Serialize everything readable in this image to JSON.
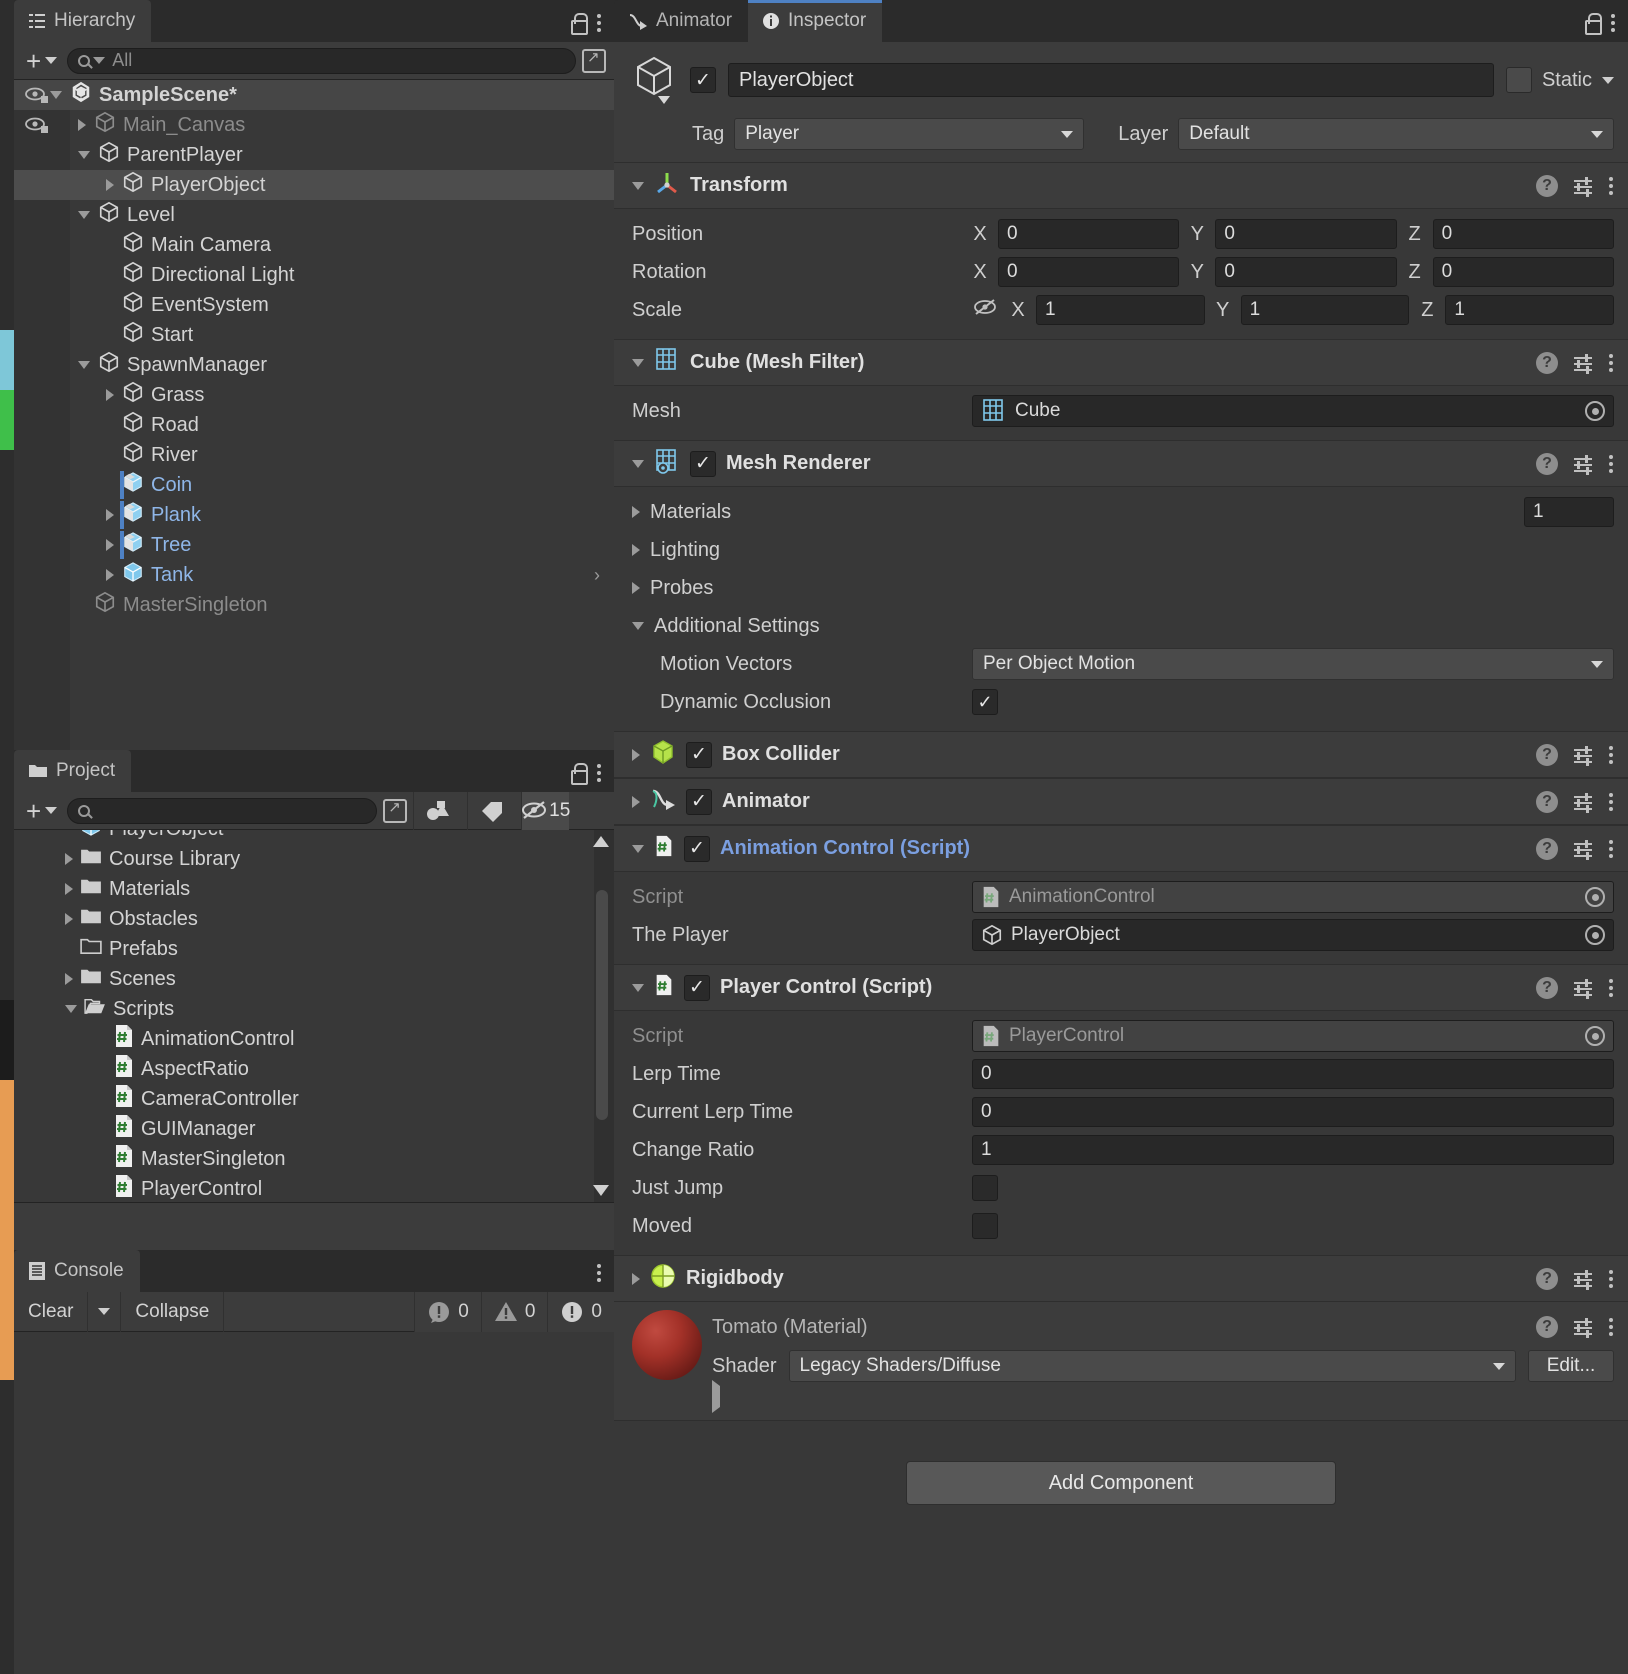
{
  "hierarchy": {
    "tab_label": "Hierarchy",
    "search_placeholder": "All",
    "search_value": "",
    "items": [
      {
        "label": "SampleScene*",
        "depth": 0,
        "arrow": "open",
        "icon": "unity-scene-icon",
        "style": "bold",
        "eye": true,
        "selected": false,
        "scene": true
      },
      {
        "label": "Main_Canvas",
        "depth": 1,
        "arrow": "closed",
        "icon": "gameobject-icon",
        "style": "dim",
        "eye": true
      },
      {
        "label": "ParentPlayer",
        "depth": 1,
        "arrow": "open",
        "icon": "gameobject-icon",
        "style": "normal"
      },
      {
        "label": "PlayerObject",
        "depth": 2,
        "arrow": "closed",
        "icon": "gameobject-icon",
        "style": "normal",
        "selected": true
      },
      {
        "label": "Level",
        "depth": 1,
        "arrow": "open",
        "icon": "gameobject-icon",
        "style": "normal"
      },
      {
        "label": "Main Camera",
        "depth": 2,
        "arrow": "none",
        "icon": "gameobject-icon",
        "style": "normal"
      },
      {
        "label": "Directional Light",
        "depth": 2,
        "arrow": "none",
        "icon": "gameobject-icon",
        "style": "normal"
      },
      {
        "label": "EventSystem",
        "depth": 2,
        "arrow": "none",
        "icon": "gameobject-icon",
        "style": "normal"
      },
      {
        "label": "Start",
        "depth": 2,
        "arrow": "none",
        "icon": "gameobject-icon",
        "style": "normal"
      },
      {
        "label": "SpawnManager",
        "depth": 1,
        "arrow": "open",
        "icon": "gameobject-icon",
        "style": "normal"
      },
      {
        "label": "Grass",
        "depth": 2,
        "arrow": "closed",
        "icon": "gameobject-icon",
        "style": "normal"
      },
      {
        "label": "Road",
        "depth": 2,
        "arrow": "none",
        "icon": "gameobject-icon",
        "style": "normal"
      },
      {
        "label": "River",
        "depth": 2,
        "arrow": "none",
        "icon": "gameobject-icon",
        "style": "normal"
      },
      {
        "label": "Coin",
        "depth": 2,
        "arrow": "none",
        "icon": "prefab-variant-icon",
        "style": "prefab",
        "mark": true
      },
      {
        "label": "Plank",
        "depth": 2,
        "arrow": "closed",
        "icon": "prefab-variant-icon",
        "style": "prefab",
        "mark": true
      },
      {
        "label": "Tree",
        "depth": 2,
        "arrow": "closed",
        "icon": "prefab-variant-icon",
        "style": "prefab",
        "mark": true
      },
      {
        "label": "Tank",
        "depth": 2,
        "arrow": "closed",
        "icon": "prefab-icon",
        "style": "prefab",
        "chevron": "›"
      },
      {
        "label": "MasterSingleton",
        "depth": 1,
        "arrow": "none",
        "icon": "gameobject-icon",
        "style": "dim"
      }
    ]
  },
  "project": {
    "tab_label": "Project",
    "search_placeholder": "",
    "search_value": "",
    "hidden_count": "15",
    "items": [
      {
        "label": "PlayerObject",
        "depth": 1,
        "arrow": "none",
        "icon": "prefab-icon",
        "clipped": true
      },
      {
        "label": "Course Library",
        "depth": 1,
        "arrow": "closed",
        "icon": "folder-icon"
      },
      {
        "label": "Materials",
        "depth": 1,
        "arrow": "closed",
        "icon": "folder-icon"
      },
      {
        "label": "Obstacles",
        "depth": 1,
        "arrow": "closed",
        "icon": "folder-icon"
      },
      {
        "label": "Prefabs",
        "depth": 1,
        "arrow": "none",
        "icon": "folder-empty-icon"
      },
      {
        "label": "Scenes",
        "depth": 1,
        "arrow": "closed",
        "icon": "folder-icon"
      },
      {
        "label": "Scripts",
        "depth": 1,
        "arrow": "open",
        "icon": "folder-open-icon"
      },
      {
        "label": "AnimationControl",
        "depth": 2,
        "arrow": "none",
        "icon": "csharp-script-icon"
      },
      {
        "label": "AspectRatio",
        "depth": 2,
        "arrow": "none",
        "icon": "csharp-script-icon"
      },
      {
        "label": "CameraController",
        "depth": 2,
        "arrow": "none",
        "icon": "csharp-script-icon"
      },
      {
        "label": "GUIManager",
        "depth": 2,
        "arrow": "none",
        "icon": "csharp-script-icon"
      },
      {
        "label": "MasterSingleton",
        "depth": 2,
        "arrow": "none",
        "icon": "csharp-script-icon"
      },
      {
        "label": "PlayerControl",
        "depth": 2,
        "arrow": "none",
        "icon": "csharp-script-icon",
        "clipped": true
      }
    ]
  },
  "console": {
    "tab_label": "Console",
    "clear_label": "Clear",
    "collapse_label": "Collapse",
    "error_count": "0",
    "warning_count": "0",
    "log_count": "0"
  },
  "inspector": {
    "tabs": [
      {
        "label": "Animator",
        "icon": "animator-icon",
        "active": false
      },
      {
        "label": "Inspector",
        "icon": "info-icon",
        "active": true
      }
    ],
    "object": {
      "name": "PlayerObject",
      "enabled": true,
      "static_label": "Static",
      "tag_label": "Tag",
      "tag_value": "Player",
      "layer_label": "Layer",
      "layer_value": "Default"
    },
    "components": [
      {
        "title": "Transform",
        "icon": "transform-icon",
        "expanded": true,
        "has_checkbox": false,
        "rows": [
          {
            "label": "Position",
            "type": "vector3",
            "x": "0",
            "y": "0",
            "z": "0"
          },
          {
            "label": "Rotation",
            "type": "vector3",
            "x": "0",
            "y": "0",
            "z": "0"
          },
          {
            "label": "Scale",
            "type": "vector3",
            "x": "1",
            "y": "1",
            "z": "1",
            "link_icon": "constrain-proportions-off-icon"
          }
        ]
      },
      {
        "title": "Cube (Mesh Filter)",
        "icon": "mesh-filter-icon",
        "expanded": true,
        "has_checkbox": false,
        "rows": [
          {
            "label": "Mesh",
            "type": "object",
            "value": "Cube",
            "value_icon": "mesh-icon"
          }
        ]
      },
      {
        "title": "Mesh Renderer",
        "icon": "mesh-renderer-icon",
        "expanded": true,
        "has_checkbox": true,
        "checked": true,
        "rows": [
          {
            "label": "Materials",
            "type": "foldout",
            "arrow": "closed",
            "count": "1"
          },
          {
            "label": "Lighting",
            "type": "foldout",
            "arrow": "closed"
          },
          {
            "label": "Probes",
            "type": "foldout",
            "arrow": "closed"
          },
          {
            "label": "Additional Settings",
            "type": "foldout",
            "arrow": "open"
          },
          {
            "label": "Motion Vectors",
            "type": "dropdown",
            "value": "Per Object Motion",
            "indent": true
          },
          {
            "label": "Dynamic Occlusion",
            "type": "checkbox",
            "checked": true,
            "indent": true
          }
        ]
      },
      {
        "title": "Box Collider",
        "icon": "box-collider-icon",
        "expanded": false,
        "has_checkbox": true,
        "checked": true,
        "rows": []
      },
      {
        "title": "Animator",
        "icon": "animator-icon",
        "expanded": false,
        "has_checkbox": true,
        "checked": true,
        "rows": []
      },
      {
        "title": "Animation Control (Script)",
        "icon": "csharp-script-icon",
        "expanded": true,
        "has_checkbox": true,
        "checked": true,
        "title_style": "script",
        "rows": [
          {
            "label": "Script",
            "type": "object",
            "value": "AnimationControl",
            "value_icon": "csharp-script-icon",
            "readonly": true
          },
          {
            "label": "The Player",
            "type": "object",
            "value": "PlayerObject",
            "value_icon": "gameobject-icon"
          }
        ]
      },
      {
        "title": "Player Control (Script)",
        "icon": "csharp-script-icon",
        "expanded": true,
        "has_checkbox": true,
        "checked": true,
        "rows": [
          {
            "label": "Script",
            "type": "object",
            "value": "PlayerControl",
            "value_icon": "csharp-script-icon",
            "readonly": true
          },
          {
            "label": "Lerp Time",
            "type": "text",
            "value": "0"
          },
          {
            "label": "Current Lerp Time",
            "type": "text",
            "value": "0"
          },
          {
            "label": "Change Ratio",
            "type": "text",
            "value": "1"
          },
          {
            "label": "Just Jump",
            "type": "checkbox",
            "checked": false
          },
          {
            "label": "Moved",
            "type": "checkbox",
            "checked": false
          }
        ]
      },
      {
        "title": "Rigidbody",
        "icon": "rigidbody-icon",
        "expanded": false,
        "has_checkbox": false,
        "rows": []
      }
    ],
    "material": {
      "title": "Tomato (Material)",
      "shader_label": "Shader",
      "shader_value": "Legacy Shaders/Diffuse",
      "edit_label": "Edit...",
      "swatch_color": "#a33128"
    },
    "add_component_label": "Add Component"
  },
  "colors": {
    "accent": "#4e81c4",
    "script_blue": "#7b9fe0",
    "prefab_blue": "#8fb6e8",
    "panel_bg": "#383838",
    "header_bg": "#3c3c3c"
  }
}
